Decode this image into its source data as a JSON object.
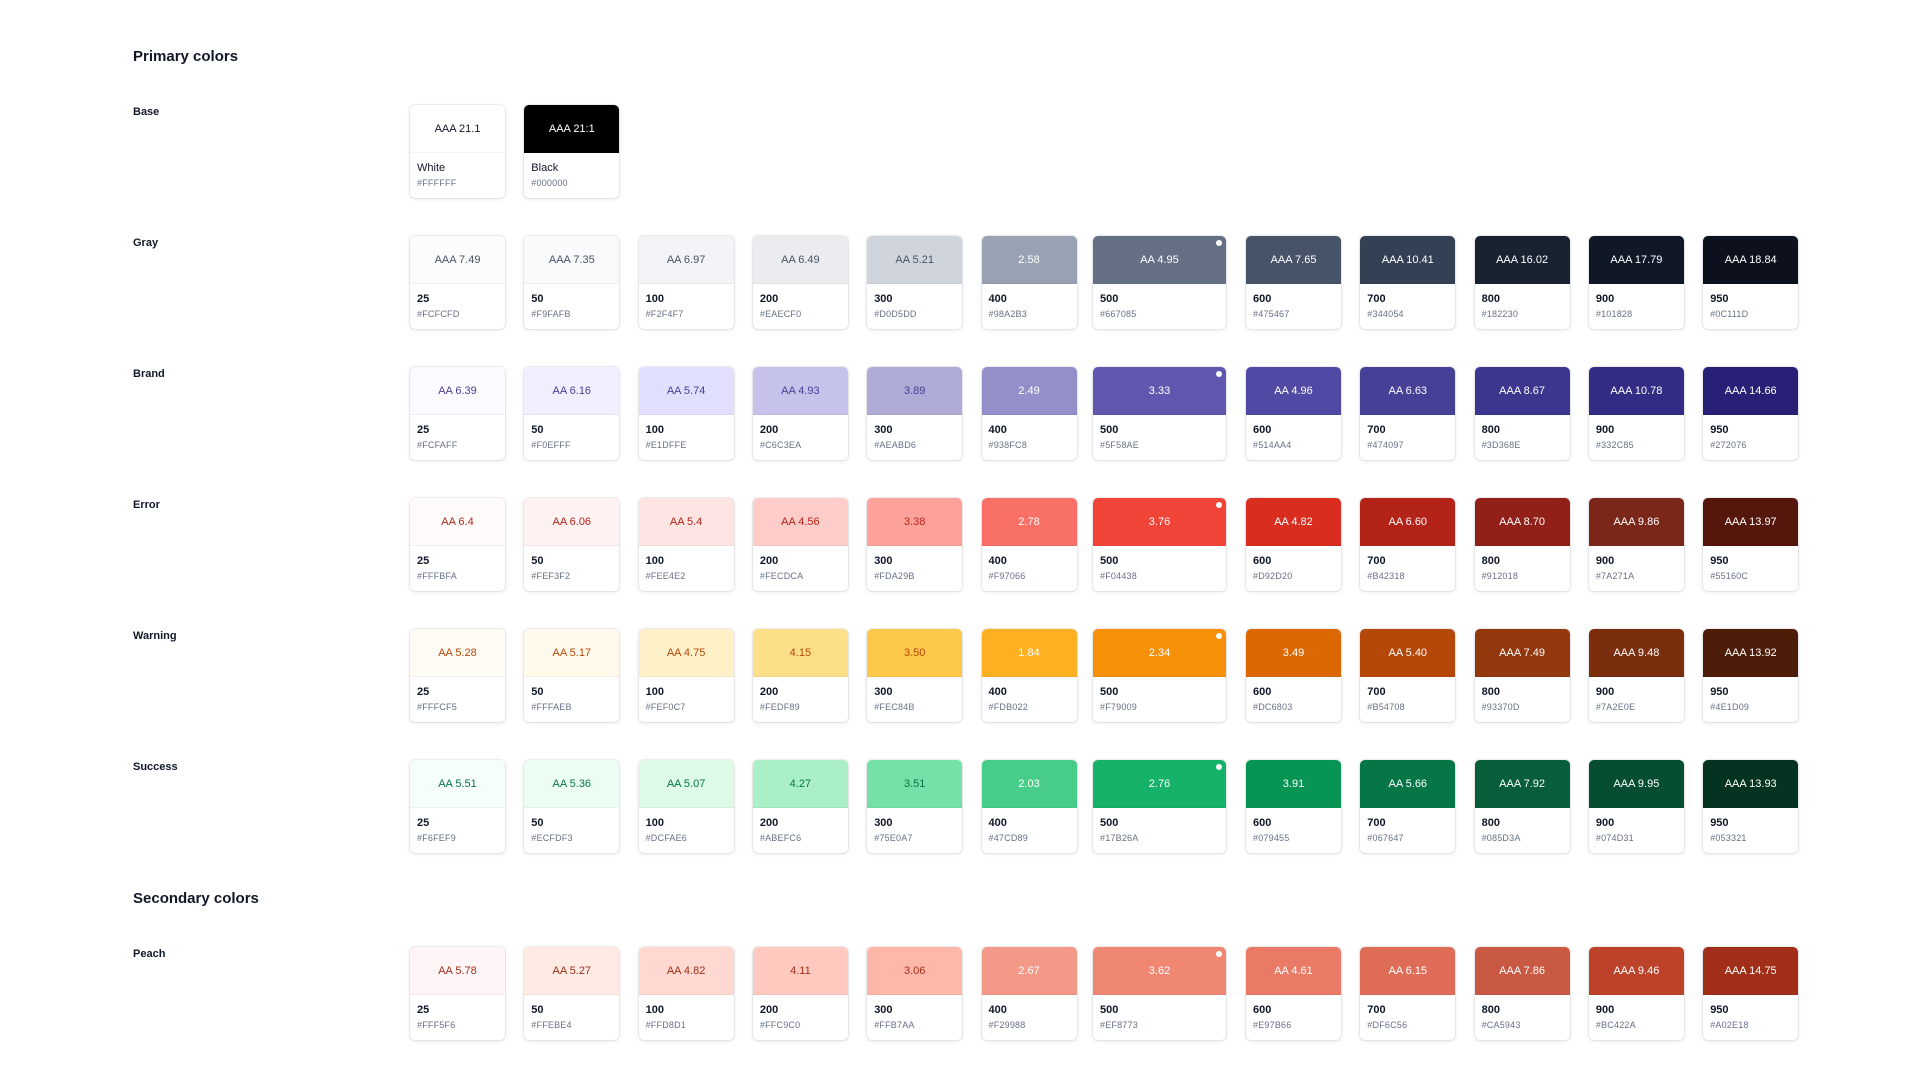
{
  "sections": {
    "primary_title": "Primary colors",
    "secondary_title": "Secondary colors"
  },
  "base": {
    "label": "Base",
    "swatches": [
      {
        "contrast": "AAA 21.1",
        "name": "White",
        "hex": "#FFFFFF",
        "fill": "#FFFFFF",
        "text_color": "#101828"
      },
      {
        "contrast": "AAA 21:1",
        "name": "Black",
        "hex": "#000000",
        "fill": "#000000",
        "text_color": "#FFFFFF"
      }
    ]
  },
  "palettes": [
    {
      "label": "Gray",
      "swatches": [
        {
          "contrast": "AAA 7.49",
          "step": "25",
          "hex": "#FCFCFD",
          "fill": "#FCFCFD",
          "text_color": "#475467"
        },
        {
          "contrast": "AAA 7.35",
          "step": "50",
          "hex": "#F9FAFB",
          "fill": "#F9FAFB",
          "text_color": "#475467"
        },
        {
          "contrast": "AA 6.97",
          "step": "100",
          "hex": "#F2F4F7",
          "fill": "#F2F4F7",
          "text_color": "#475467"
        },
        {
          "contrast": "AA 6.49",
          "step": "200",
          "hex": "#EAECF0",
          "fill": "#EAECF0",
          "text_color": "#475467"
        },
        {
          "contrast": "AA 5.21",
          "step": "300",
          "hex": "#D0D5DD",
          "fill": "#D0D5DD",
          "text_color": "#475467"
        },
        {
          "contrast": "2.58",
          "step": "400",
          "hex": "#98A2B3",
          "fill": "#98A2B3",
          "text_color": "#FFFFFF"
        },
        {
          "contrast": "AA 4.95",
          "step": "500",
          "hex": "#667085",
          "fill": "#667085",
          "text_color": "#FFFFFF",
          "primary": true
        },
        {
          "contrast": "AAA 7.65",
          "step": "600",
          "hex": "#475467",
          "fill": "#475467",
          "text_color": "#FFFFFF"
        },
        {
          "contrast": "AAA 10.41",
          "step": "700",
          "hex": "#344054",
          "fill": "#344054",
          "text_color": "#FFFFFF"
        },
        {
          "contrast": "AAA 16.02",
          "step": "800",
          "hex": "#182230",
          "fill": "#182230",
          "text_color": "#FFFFFF"
        },
        {
          "contrast": "AAA 17.79",
          "step": "900",
          "hex": "#101828",
          "fill": "#101828",
          "text_color": "#FFFFFF"
        },
        {
          "contrast": "AAA 18.84",
          "step": "950",
          "hex": "#0C111D",
          "fill": "#0C111D",
          "text_color": "#FFFFFF"
        }
      ]
    },
    {
      "label": "Brand",
      "swatches": [
        {
          "contrast": "AA 6.39",
          "step": "25",
          "hex": "#FCFAFF",
          "fill": "#FCFAFF",
          "text_color": "#474097"
        },
        {
          "contrast": "AA 6.16",
          "step": "50",
          "hex": "#F0EFFF",
          "fill": "#F0EFFF",
          "text_color": "#474097"
        },
        {
          "contrast": "AA 5.74",
          "step": "100",
          "hex": "#E1DFFE",
          "fill": "#E1DFFE",
          "text_color": "#474097"
        },
        {
          "contrast": "AA 4.93",
          "step": "200",
          "hex": "#C6C3EA",
          "fill": "#C6C3EA",
          "text_color": "#474097"
        },
        {
          "contrast": "3.89",
          "step": "300",
          "hex": "#AEABD6",
          "fill": "#AEABD6",
          "text_color": "#474097"
        },
        {
          "contrast": "2.49",
          "step": "400",
          "hex": "#938FC8",
          "fill": "#938FC8",
          "text_color": "#FFFFFF"
        },
        {
          "contrast": "3.33",
          "step": "500",
          "hex": "#5F58AE",
          "fill": "#5F58AE",
          "text_color": "#FFFFFF",
          "primary": true
        },
        {
          "contrast": "AA 4.96",
          "step": "600",
          "hex": "#514AA4",
          "fill": "#514AA4",
          "text_color": "#FFFFFF"
        },
        {
          "contrast": "AA 6.63",
          "step": "700",
          "hex": "#474097",
          "fill": "#474097",
          "text_color": "#FFFFFF"
        },
        {
          "contrast": "AAA 8.67",
          "step": "800",
          "hex": "#3D368E",
          "fill": "#3D368E",
          "text_color": "#FFFFFF"
        },
        {
          "contrast": "AAA 10.78",
          "step": "900",
          "hex": "#332C85",
          "fill": "#332C85",
          "text_color": "#FFFFFF"
        },
        {
          "contrast": "AAA 14.66",
          "step": "950",
          "hex": "#272076",
          "fill": "#272076",
          "text_color": "#FFFFFF"
        }
      ]
    },
    {
      "label": "Error",
      "swatches": [
        {
          "contrast": "AA 6.4",
          "step": "25",
          "hex": "#FFFBFA",
          "fill": "#FFFBFA",
          "text_color": "#B42318"
        },
        {
          "contrast": "AA 6.06",
          "step": "50",
          "hex": "#FEF3F2",
          "fill": "#FEF3F2",
          "text_color": "#B42318"
        },
        {
          "contrast": "AA 5.4",
          "step": "100",
          "hex": "#FEE4E2",
          "fill": "#FEE4E2",
          "text_color": "#B42318"
        },
        {
          "contrast": "AA 4.56",
          "step": "200",
          "hex": "#FECDCA",
          "fill": "#FECDCA",
          "text_color": "#B42318"
        },
        {
          "contrast": "3.38",
          "step": "300",
          "hex": "#FDA29B",
          "fill": "#FDA29B",
          "text_color": "#B42318"
        },
        {
          "contrast": "2.78",
          "step": "400",
          "hex": "#F97066",
          "fill": "#F97066",
          "text_color": "#FFFFFF"
        },
        {
          "contrast": "3.76",
          "step": "500",
          "hex": "#F04438",
          "fill": "#F04438",
          "text_color": "#FFFFFF",
          "primary": true
        },
        {
          "contrast": "AA 4.82",
          "step": "600",
          "hex": "#D92D20",
          "fill": "#D92D20",
          "text_color": "#FFFFFF"
        },
        {
          "contrast": "AA 6.60",
          "step": "700",
          "hex": "#B42318",
          "fill": "#B42318",
          "text_color": "#FFFFFF"
        },
        {
          "contrast": "AAA 8.70",
          "step": "800",
          "hex": "#912018",
          "fill": "#912018",
          "text_color": "#FFFFFF"
        },
        {
          "contrast": "AAA 9.86",
          "step": "900",
          "hex": "#7A271A",
          "fill": "#7A271A",
          "text_color": "#FFFFFF"
        },
        {
          "contrast": "AAA 13.97",
          "step": "950",
          "hex": "#55160C",
          "fill": "#55160C",
          "text_color": "#FFFFFF"
        }
      ]
    },
    {
      "label": "Warning",
      "swatches": [
        {
          "contrast": "AA 5.28",
          "step": "25",
          "hex": "#FFFCF5",
          "fill": "#FFFCF5",
          "text_color": "#B54708"
        },
        {
          "contrast": "AA 5.17",
          "step": "50",
          "hex": "#FFFAEB",
          "fill": "#FFFAEB",
          "text_color": "#B54708"
        },
        {
          "contrast": "AA 4.75",
          "step": "100",
          "hex": "#FEF0C7",
          "fill": "#FEF0C7",
          "text_color": "#B54708"
        },
        {
          "contrast": "4.15",
          "step": "200",
          "hex": "#FEDF89",
          "fill": "#FEDF89",
          "text_color": "#B54708"
        },
        {
          "contrast": "3.50",
          "step": "300",
          "hex": "#FEC84B",
          "fill": "#FEC84B",
          "text_color": "#B54708"
        },
        {
          "contrast": "1.84",
          "step": "400",
          "hex": "#FDB022",
          "fill": "#FDB022",
          "text_color": "#FFFFFF"
        },
        {
          "contrast": "2.34",
          "step": "500",
          "hex": "#F79009",
          "fill": "#F79009",
          "text_color": "#FFFFFF",
          "primary": true
        },
        {
          "contrast": "3.49",
          "step": "600",
          "hex": "#DC6803",
          "fill": "#DC6803",
          "text_color": "#FFFFFF"
        },
        {
          "contrast": "AA 5.40",
          "step": "700",
          "hex": "#B54708",
          "fill": "#B54708",
          "text_color": "#FFFFFF"
        },
        {
          "contrast": "AAA 7.49",
          "step": "800",
          "hex": "#93370D",
          "fill": "#93370D",
          "text_color": "#FFFFFF"
        },
        {
          "contrast": "AAA 9.48",
          "step": "900",
          "hex": "#7A2E0E",
          "fill": "#7A2E0E",
          "text_color": "#FFFFFF"
        },
        {
          "contrast": "AAA 13.92",
          "step": "950",
          "hex": "#4E1D09",
          "fill": "#4E1D09",
          "text_color": "#FFFFFF"
        }
      ]
    },
    {
      "label": "Success",
      "swatches": [
        {
          "contrast": "AA 5.51",
          "step": "25",
          "hex": "#F6FEF9",
          "fill": "#F6FEF9",
          "text_color": "#067647"
        },
        {
          "contrast": "AA 5.36",
          "step": "50",
          "hex": "#ECFDF3",
          "fill": "#ECFDF3",
          "text_color": "#067647"
        },
        {
          "contrast": "AA 5.07",
          "step": "100",
          "hex": "#DCFAE6",
          "fill": "#DCFAE6",
          "text_color": "#067647"
        },
        {
          "contrast": "4.27",
          "step": "200",
          "hex": "#ABEFC6",
          "fill": "#ABEFC6",
          "text_color": "#067647"
        },
        {
          "contrast": "3.51",
          "step": "300",
          "hex": "#75E0A7",
          "fill": "#75E0A7",
          "text_color": "#067647"
        },
        {
          "contrast": "2.03",
          "step": "400",
          "hex": "#47CD89",
          "fill": "#47CD89",
          "text_color": "#FFFFFF"
        },
        {
          "contrast": "2.76",
          "step": "500",
          "hex": "#17B26A",
          "fill": "#17B26A",
          "text_color": "#FFFFFF",
          "primary": true
        },
        {
          "contrast": "3.91",
          "step": "600",
          "hex": "#079455",
          "fill": "#079455",
          "text_color": "#FFFFFF"
        },
        {
          "contrast": "AA 5.66",
          "step": "700",
          "hex": "#067647",
          "fill": "#067647",
          "text_color": "#FFFFFF"
        },
        {
          "contrast": "AAA 7.92",
          "step": "800",
          "hex": "#085D3A",
          "fill": "#085D3A",
          "text_color": "#FFFFFF"
        },
        {
          "contrast": "AAA 9.95",
          "step": "900",
          "hex": "#074D31",
          "fill": "#074D31",
          "text_color": "#FFFFFF"
        },
        {
          "contrast": "AAA 13.93",
          "step": "950",
          "hex": "#053321",
          "fill": "#053321",
          "text_color": "#FFFFFF"
        }
      ]
    },
    {
      "label": "Peach",
      "swatches": [
        {
          "contrast": "AA 5.78",
          "step": "25",
          "hex": "#FFF5F6",
          "fill": "#FFF5F6",
          "text_color": "#A02E18"
        },
        {
          "contrast": "AA 5.27",
          "step": "50",
          "hex": "#FFEBE4",
          "fill": "#FFEBE4",
          "text_color": "#A02E18"
        },
        {
          "contrast": "AA 4.82",
          "step": "100",
          "hex": "#FFD8D1",
          "fill": "#FFD8D1",
          "text_color": "#A02E18"
        },
        {
          "contrast": "4.11",
          "step": "200",
          "hex": "#FFC9C0",
          "fill": "#FFC9C0",
          "text_color": "#A02E18"
        },
        {
          "contrast": "3.06",
          "step": "300",
          "hex": "#FFB7AA",
          "fill": "#FFB7AA",
          "text_color": "#A02E18"
        },
        {
          "contrast": "2.67",
          "step": "400",
          "hex": "#F29988",
          "fill": "#F29988",
          "text_color": "#FFFFFF"
        },
        {
          "contrast": "3.62",
          "step": "500",
          "hex": "#EF8773",
          "fill": "#EF8773",
          "text_color": "#FFFFFF",
          "primary": true
        },
        {
          "contrast": "AA 4.61",
          "step": "600",
          "hex": "#E97B66",
          "fill": "#E97B66",
          "text_color": "#FFFFFF"
        },
        {
          "contrast": "AA 6.15",
          "step": "700",
          "hex": "#DF6C56",
          "fill": "#DF6C56",
          "text_color": "#FFFFFF"
        },
        {
          "contrast": "AAA 7.86",
          "step": "800",
          "hex": "#CA5943",
          "fill": "#CA5943",
          "text_color": "#FFFFFF"
        },
        {
          "contrast": "AAA 9.46",
          "step": "900",
          "hex": "#BC422A",
          "fill": "#BC422A",
          "text_color": "#FFFFFF"
        },
        {
          "contrast": "AAA 14.75",
          "step": "950",
          "hex": "#A02E18",
          "fill": "#A02E18",
          "text_color": "#FFFFFF"
        }
      ]
    }
  ]
}
